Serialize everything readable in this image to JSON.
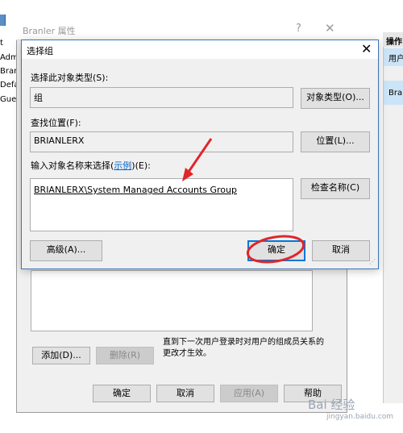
{
  "background": {
    "left_items": [
      "t",
      "Admi",
      "Bran",
      "Defa",
      "Gues"
    ],
    "right_header": "操作",
    "right_items": [
      "用户",
      "Bra"
    ]
  },
  "props_dialog": {
    "title": "Branler 属性",
    "help_glyph": "?",
    "close_glyph": "✕",
    "add_button": "添加(D)...",
    "remove_button": "删除(R)",
    "note": "直到下一次用户登录时对用户的组成员关系的更改才生效。",
    "ok_button": "确定",
    "cancel_button": "取消",
    "apply_button": "应用(A)",
    "help_button": "帮助"
  },
  "select_group": {
    "title": "选择组",
    "close_glyph": "✕",
    "object_type_label": "选择此对象类型(S):",
    "object_type_value": "组",
    "object_type_button": "对象类型(O)...",
    "location_label": "查找位置(F):",
    "location_value": "BRIANLERX",
    "location_button": "位置(L)...",
    "enter_label_prefix": "输入对象名称来选择(",
    "enter_label_link": "示例",
    "enter_label_suffix": ")(E):",
    "enter_value": "BRIANLERX\\System Managed Accounts Group",
    "check_names_button": "检查名称(C)",
    "advanced_button": "高级(A)...",
    "ok_button": "确定",
    "cancel_button": "取消"
  },
  "watermark": {
    "text": "Bai 经验",
    "sub": "jingyan.baidu.com"
  },
  "annotation_color": "#e0262b"
}
